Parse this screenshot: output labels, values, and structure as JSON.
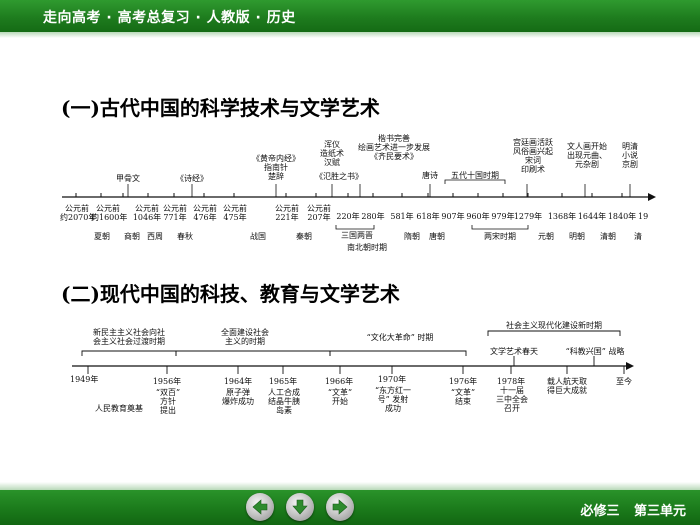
{
  "header": {
    "title": "走向高考 · 高考总复习 · 人教版 · 历史"
  },
  "footer": {
    "label": "必修三 第三单元",
    "nav": [
      "back-arrow-icon",
      "down-arrow-icon",
      "forward-arrow-icon"
    ]
  },
  "colors": {
    "header_green": "#1d7a1d",
    "nav_arrow_green": "#2e8b2e"
  },
  "section1": {
    "title": "(一)古代中国的科学技术与文学艺术",
    "top_labels": {
      "jiaguwen": "甲骨文",
      "shijing": "《诗经》",
      "huangdi": [
        "《黄帝内经》",
        "指南针",
        "楚辞"
      ],
      "zhidi": [
        "浑仪",
        "造纸术",
        "汉赋"
      ],
      "fanzhou": "《氾胜之书》",
      "kaishu": [
        "楷书完善",
        "绘画艺术进一步发展",
        "《齐民要术》"
      ],
      "tangshi": "唐诗",
      "wudai": "五代十国时期",
      "songci": [
        "宫廷画活跃",
        "风俗画兴起",
        "宋词",
        "印刷术"
      ],
      "wenren": [
        "文人画开始",
        "出现元曲、",
        "元杂剧"
      ],
      "mingqing": [
        "明清",
        "小说",
        "京剧"
      ]
    },
    "dates": [
      [
        "公元前",
        "约2070年"
      ],
      [
        "公元前",
        "约1600年"
      ],
      [
        "公元前",
        "1046年"
      ],
      [
        "公元前",
        "771年"
      ],
      [
        "公元前",
        "476年"
      ],
      [
        "公元前",
        "475年"
      ],
      [
        "公元前",
        "221年"
      ],
      [
        "公元前",
        "207年"
      ],
      "220年",
      "280年",
      "581年",
      "618年",
      "907年",
      "960年",
      "979年",
      "1279年",
      "1368年",
      "1644年",
      "1840年",
      "19"
    ],
    "dynasties": {
      "xia": "夏朝",
      "shang": "商朝",
      "xizhou": "西周",
      "chunqiu": "春秋",
      "zhanguo": "战国",
      "qin": "秦朝",
      "sanguo": "三国两晋",
      "nanbei": "南北朝时期",
      "sui": "隋朝",
      "tang": "唐朝",
      "liangsong": "两宋时期",
      "yuan": "元朝",
      "ming": "明朝",
      "qing": "清朝",
      "qing_end": "清"
    }
  },
  "section2": {
    "title": "(二)现代中国的科技、教育与文学艺术",
    "periods": {
      "p1": [
        "新民主主义社会向社",
        "会主义社会过渡时期"
      ],
      "p2": [
        "全面建设社会",
        "主义的时期"
      ],
      "p3": "“文化大革命” 时期",
      "p4": "社会主义现代化建设新时期"
    },
    "upper_events": {
      "wenyi": "文学艺术春天",
      "kejiao": "“科教兴国” 战略"
    },
    "years": {
      "y1949": "1949年",
      "y1956": "1956年",
      "y1964": "1964年",
      "y1965": "1965年",
      "y1966": "1966年",
      "y1970": "1970年",
      "y1976": "1976年",
      "y1978": "1978年",
      "zhijin": "至今"
    },
    "lower_events": {
      "jiaoyu": "人民教育奠基",
      "shuangbai": [
        "“双百”",
        "方针",
        "提出"
      ],
      "yuanzi": [
        "原子弹",
        "爆炸成功"
      ],
      "yidaosu": [
        "人工合成",
        "结晶牛胰",
        "岛素"
      ],
      "wenge_start": [
        "“文革”",
        "开始"
      ],
      "dongfanghong": [
        "“东方红一",
        "号” 发射",
        "成功"
      ],
      "wenge_end": [
        "“文革”",
        "结束"
      ],
      "shiyijie": [
        "十一届",
        "三中全会",
        "召开"
      ],
      "hangtian": [
        "载人航天取",
        "得巨大成就"
      ]
    }
  }
}
